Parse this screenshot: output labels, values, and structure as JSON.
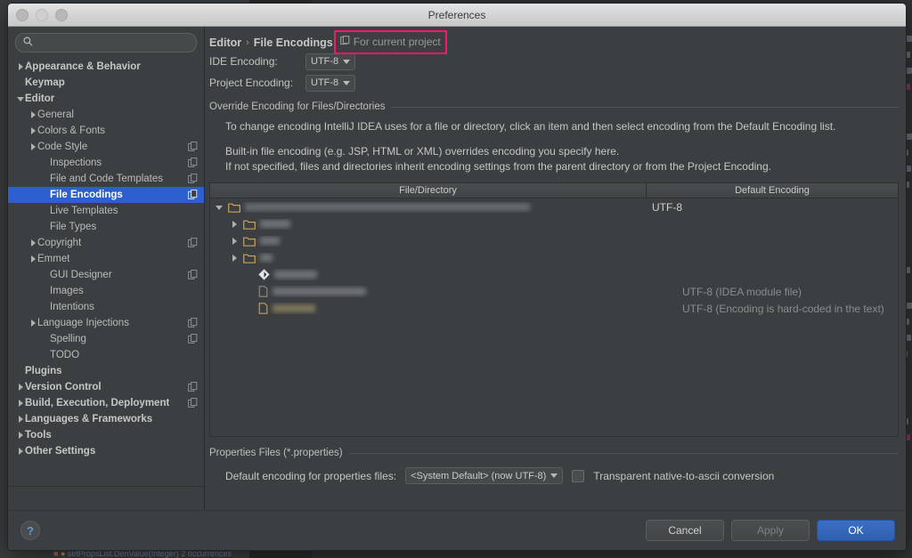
{
  "window": {
    "title": "Preferences",
    "traffic_lights": [
      "close",
      "minimize",
      "zoom"
    ]
  },
  "sidebar": {
    "search": {
      "value": "",
      "placeholder": ""
    },
    "items": [
      {
        "label": "Appearance & Behavior",
        "indent": 0,
        "arrow": "collapsed",
        "bold": true,
        "copy_icon": false,
        "selected": false
      },
      {
        "label": "Keymap",
        "indent": 0,
        "arrow": "none",
        "bold": true,
        "copy_icon": false,
        "selected": false
      },
      {
        "label": "Editor",
        "indent": 0,
        "arrow": "expanded",
        "bold": true,
        "copy_icon": false,
        "selected": false
      },
      {
        "label": "General",
        "indent": 1,
        "arrow": "collapsed",
        "bold": false,
        "copy_icon": false,
        "selected": false
      },
      {
        "label": "Colors & Fonts",
        "indent": 1,
        "arrow": "collapsed",
        "bold": false,
        "copy_icon": false,
        "selected": false
      },
      {
        "label": "Code Style",
        "indent": 1,
        "arrow": "collapsed",
        "bold": false,
        "copy_icon": true,
        "selected": false
      },
      {
        "label": "Inspections",
        "indent": 2,
        "arrow": "none",
        "bold": false,
        "copy_icon": true,
        "selected": false
      },
      {
        "label": "File and Code Templates",
        "indent": 2,
        "arrow": "none",
        "bold": false,
        "copy_icon": true,
        "selected": false
      },
      {
        "label": "File Encodings",
        "indent": 2,
        "arrow": "none",
        "bold": true,
        "copy_icon": true,
        "selected": true
      },
      {
        "label": "Live Templates",
        "indent": 2,
        "arrow": "none",
        "bold": false,
        "copy_icon": false,
        "selected": false
      },
      {
        "label": "File Types",
        "indent": 2,
        "arrow": "none",
        "bold": false,
        "copy_icon": false,
        "selected": false
      },
      {
        "label": "Copyright",
        "indent": 1,
        "arrow": "collapsed",
        "bold": false,
        "copy_icon": true,
        "selected": false
      },
      {
        "label": "Emmet",
        "indent": 1,
        "arrow": "collapsed",
        "bold": false,
        "copy_icon": false,
        "selected": false
      },
      {
        "label": "GUI Designer",
        "indent": 2,
        "arrow": "none",
        "bold": false,
        "copy_icon": true,
        "selected": false
      },
      {
        "label": "Images",
        "indent": 2,
        "arrow": "none",
        "bold": false,
        "copy_icon": false,
        "selected": false
      },
      {
        "label": "Intentions",
        "indent": 2,
        "arrow": "none",
        "bold": false,
        "copy_icon": false,
        "selected": false
      },
      {
        "label": "Language Injections",
        "indent": 1,
        "arrow": "collapsed",
        "bold": false,
        "copy_icon": true,
        "selected": false
      },
      {
        "label": "Spelling",
        "indent": 2,
        "arrow": "none",
        "bold": false,
        "copy_icon": true,
        "selected": false
      },
      {
        "label": "TODO",
        "indent": 2,
        "arrow": "none",
        "bold": false,
        "copy_icon": false,
        "selected": false
      },
      {
        "label": "Plugins",
        "indent": 0,
        "arrow": "none",
        "bold": true,
        "copy_icon": false,
        "selected": false
      },
      {
        "label": "Version Control",
        "indent": 0,
        "arrow": "collapsed",
        "bold": true,
        "copy_icon": true,
        "selected": false
      },
      {
        "label": "Build, Execution, Deployment",
        "indent": 0,
        "arrow": "collapsed",
        "bold": true,
        "copy_icon": true,
        "selected": false
      },
      {
        "label": "Languages & Frameworks",
        "indent": 0,
        "arrow": "collapsed",
        "bold": true,
        "copy_icon": false,
        "selected": false
      },
      {
        "label": "Tools",
        "indent": 0,
        "arrow": "collapsed",
        "bold": true,
        "copy_icon": false,
        "selected": false
      },
      {
        "label": "Other Settings",
        "indent": 0,
        "arrow": "collapsed",
        "bold": true,
        "copy_icon": false,
        "selected": false
      }
    ]
  },
  "main": {
    "breadcrumb": {
      "parent": "Editor",
      "separator": "›",
      "current": "File Encodings"
    },
    "scope_badge": {
      "label": "For current project",
      "highlight_color": "#f5186b"
    },
    "ide_encoding": {
      "label": "IDE Encoding:",
      "value": "UTF-8"
    },
    "project_encoding": {
      "label": "Project Encoding:",
      "value": "UTF-8"
    },
    "override_group": {
      "title": "Override Encoding for Files/Directories",
      "line1": "To change encoding IntelliJ IDEA uses for a file or directory, click an item and then select encoding from the Default Encoding list.",
      "line2": "Built-in file encoding (e.g. JSP, HTML or XML) overrides encoding you specify here.",
      "line3": "If not specified, files and directories inherit encoding settings from the parent directory or from the Project Encoding."
    },
    "table": {
      "columns": [
        "File/Directory",
        "Default Encoding"
      ],
      "rows": [
        {
          "icon": "folder-open",
          "arrow": "expanded",
          "indent": 0,
          "name_redacted": true,
          "redact_width": 320,
          "encoding": "UTF-8",
          "encoding_style": "strong"
        },
        {
          "icon": "folder",
          "arrow": "collapsed",
          "indent": 1,
          "name_redacted": true,
          "redact_width": 34,
          "encoding": "",
          "encoding_style": "dim"
        },
        {
          "icon": "folder",
          "arrow": "collapsed",
          "indent": 1,
          "name_redacted": true,
          "redact_width": 22,
          "encoding": "",
          "encoding_style": "dim"
        },
        {
          "icon": "folder",
          "arrow": "collapsed",
          "indent": 1,
          "name_redacted": true,
          "redact_width": 14,
          "encoding": "",
          "encoding_style": "dim"
        },
        {
          "icon": "diamond",
          "arrow": "none",
          "indent": 2,
          "name_redacted": true,
          "redact_width": 48,
          "encoding": "",
          "encoding_style": "dim"
        },
        {
          "icon": "file",
          "arrow": "none",
          "indent": 2,
          "name_redacted": true,
          "redact_width": 105,
          "encoding": "UTF-8 (IDEA module file)",
          "encoding_style": "dim"
        },
        {
          "icon": "file-warm",
          "arrow": "none",
          "indent": 2,
          "name_redacted": true,
          "redact_width": 48,
          "encoding": "UTF-8 (Encoding is hard-coded in the text)",
          "encoding_style": "dim"
        }
      ]
    },
    "properties_group": {
      "title": "Properties Files (*.properties)",
      "default_encoding_label": "Default encoding for properties files:",
      "default_encoding_value": "<System Default> (now UTF-8)",
      "transparent_label": "Transparent native-to-ascii conversion",
      "transparent_checked": false
    }
  },
  "footer": {
    "help": "?",
    "cancel": "Cancel",
    "apply": "Apply",
    "apply_enabled": false,
    "ok": "OK"
  },
  "background": {
    "status_line": "setPropsList.DenValue(Integer)  2 occurrences"
  }
}
